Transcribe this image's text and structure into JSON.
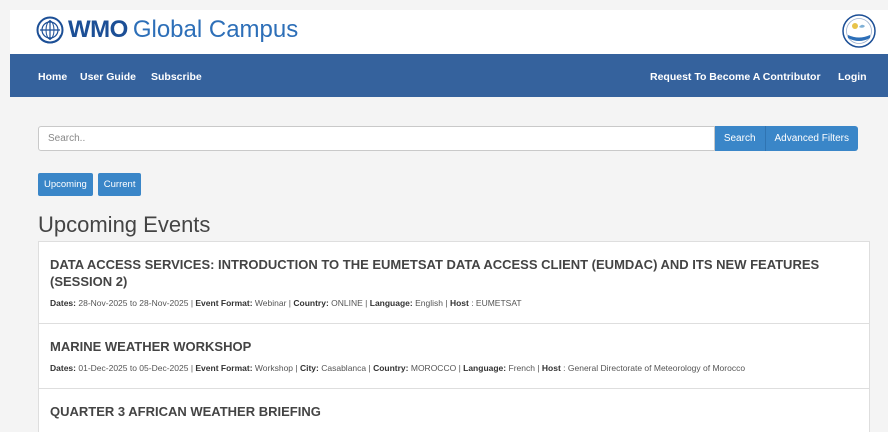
{
  "header": {
    "brand_wmo": "WMO",
    "brand_rest": "Global Campus",
    "brand_color": "#1c4f96"
  },
  "nav": {
    "home": "Home",
    "user_guide": "User Guide",
    "subscribe": "Subscribe",
    "contributor": "Request To Become A Contributor",
    "login": "Login",
    "bg_color": "#35629d"
  },
  "search": {
    "placeholder": "Search..",
    "search_label": "Search",
    "advanced_label": "Advanced Filters"
  },
  "tabs": {
    "upcoming": "Upcoming",
    "current": "Current"
  },
  "page_title": "Upcoming Events",
  "events": [
    {
      "title": "DATA ACCESS SERVICES: INTRODUCTION TO THE EUMETSAT DATA ACCESS CLIENT (EUMDAC) AND ITS NEW FEATURES (SESSION 2)",
      "dates_label": "Dates:",
      "dates": "28-Nov-2025 to 28-Nov-2025",
      "format_label": "Event Format:",
      "format": "Webinar",
      "country_label": "Country:",
      "country": "ONLINE",
      "language_label": "Language:",
      "language": "English",
      "host_label": "Host",
      "host": "EUMETSAT"
    },
    {
      "title": "MARINE WEATHER WORKSHOP",
      "dates_label": "Dates:",
      "dates": "01-Dec-2025 to 05-Dec-2025",
      "format_label": "Event Format:",
      "format": "Workshop",
      "city_label": "City:",
      "city": "Casablanca",
      "country_label": "Country:",
      "country": "MOROCCO",
      "language_label": "Language:",
      "language": "French",
      "host_label": "Host",
      "host": "General Directorate of Meteorology of Morocco"
    },
    {
      "title": "QUARTER 3 AFRICAN WEATHER BRIEFING"
    }
  ],
  "icons": {
    "brand_logo": "un-emblem-icon",
    "corner_logo": "organization-seal-icon"
  }
}
